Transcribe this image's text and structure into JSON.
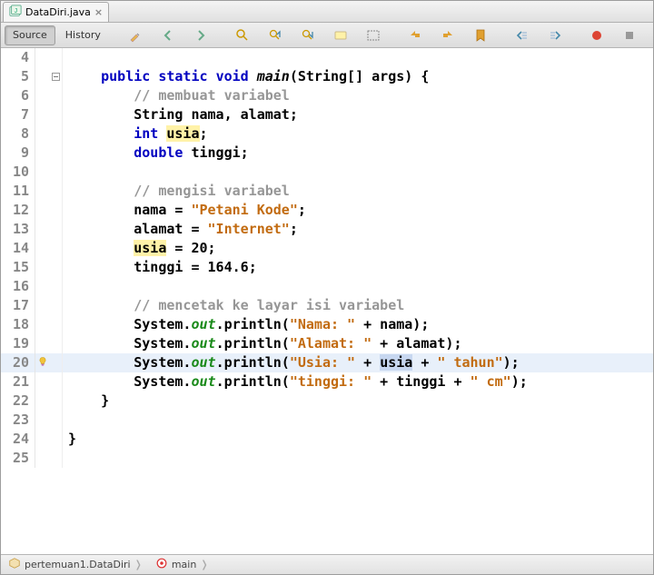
{
  "tab": {
    "filename": "DataDiri.java",
    "icon": "java-class-icon"
  },
  "toolbar": {
    "source_label": "Source",
    "history_label": "History"
  },
  "lines": [
    {
      "n": 4,
      "tokens": []
    },
    {
      "n": 5,
      "fold": "minus",
      "tokens": [
        {
          "cls": "punct",
          "t": "    "
        },
        {
          "cls": "kw",
          "t": "public"
        },
        {
          "cls": "punct",
          "t": " "
        },
        {
          "cls": "kw",
          "t": "static"
        },
        {
          "cls": "punct",
          "t": " "
        },
        {
          "cls": "kw",
          "t": "void"
        },
        {
          "cls": "punct",
          "t": " "
        },
        {
          "cls": "ident fn",
          "t": "main"
        },
        {
          "cls": "punct",
          "t": "(String[] args) {"
        }
      ]
    },
    {
      "n": 6,
      "tokens": [
        {
          "cls": "punct",
          "t": "        "
        },
        {
          "cls": "comment",
          "t": "// membuat variabel"
        }
      ]
    },
    {
      "n": 7,
      "tokens": [
        {
          "cls": "punct",
          "t": "        "
        },
        {
          "cls": "ident",
          "t": "String nama, alamat;"
        }
      ]
    },
    {
      "n": 8,
      "tokens": [
        {
          "cls": "punct",
          "t": "        "
        },
        {
          "cls": "kw",
          "t": "int"
        },
        {
          "cls": "punct",
          "t": " "
        },
        {
          "cls": "ident hl",
          "t": "usia"
        },
        {
          "cls": "punct",
          "t": ";"
        }
      ]
    },
    {
      "n": 9,
      "tokens": [
        {
          "cls": "punct",
          "t": "        "
        },
        {
          "cls": "kw",
          "t": "double"
        },
        {
          "cls": "punct",
          "t": " "
        },
        {
          "cls": "ident",
          "t": "tinggi;"
        }
      ]
    },
    {
      "n": 10,
      "tokens": []
    },
    {
      "n": 11,
      "tokens": [
        {
          "cls": "punct",
          "t": "        "
        },
        {
          "cls": "comment",
          "t": "// mengisi variabel"
        }
      ]
    },
    {
      "n": 12,
      "tokens": [
        {
          "cls": "punct",
          "t": "        "
        },
        {
          "cls": "ident",
          "t": "nama = "
        },
        {
          "cls": "str",
          "t": "\"Petani Kode\""
        },
        {
          "cls": "punct",
          "t": ";"
        }
      ]
    },
    {
      "n": 13,
      "tokens": [
        {
          "cls": "punct",
          "t": "        "
        },
        {
          "cls": "ident",
          "t": "alamat = "
        },
        {
          "cls": "str",
          "t": "\"Internet\""
        },
        {
          "cls": "punct",
          "t": ";"
        }
      ]
    },
    {
      "n": 14,
      "tokens": [
        {
          "cls": "punct",
          "t": "        "
        },
        {
          "cls": "ident hl",
          "t": "usia"
        },
        {
          "cls": "ident",
          "t": " = "
        },
        {
          "cls": "num",
          "t": "20"
        },
        {
          "cls": "punct",
          "t": ";"
        }
      ]
    },
    {
      "n": 15,
      "tokens": [
        {
          "cls": "punct",
          "t": "        "
        },
        {
          "cls": "ident",
          "t": "tinggi = "
        },
        {
          "cls": "num",
          "t": "164.6"
        },
        {
          "cls": "punct",
          "t": ";"
        }
      ]
    },
    {
      "n": 16,
      "tokens": []
    },
    {
      "n": 17,
      "tokens": [
        {
          "cls": "punct",
          "t": "        "
        },
        {
          "cls": "comment",
          "t": "// mencetak ke layar isi variabel"
        }
      ]
    },
    {
      "n": 18,
      "tokens": [
        {
          "cls": "punct",
          "t": "        "
        },
        {
          "cls": "ident",
          "t": "System."
        },
        {
          "cls": "out",
          "t": "out"
        },
        {
          "cls": "ident",
          "t": ".println("
        },
        {
          "cls": "str",
          "t": "\"Nama: \""
        },
        {
          "cls": "ident",
          "t": " + nama);"
        }
      ]
    },
    {
      "n": 19,
      "tokens": [
        {
          "cls": "punct",
          "t": "        "
        },
        {
          "cls": "ident",
          "t": "System."
        },
        {
          "cls": "out",
          "t": "out"
        },
        {
          "cls": "ident",
          "t": ".println("
        },
        {
          "cls": "str",
          "t": "\"Alamat: \""
        },
        {
          "cls": "ident",
          "t": " + alamat);"
        }
      ]
    },
    {
      "n": 20,
      "current": true,
      "glyph": "bulb",
      "tokens": [
        {
          "cls": "punct",
          "t": "        "
        },
        {
          "cls": "ident",
          "t": "System."
        },
        {
          "cls": "out",
          "t": "out"
        },
        {
          "cls": "ident",
          "t": ".println("
        },
        {
          "cls": "str",
          "t": "\"Usia: \""
        },
        {
          "cls": "ident",
          "t": " + "
        },
        {
          "cls": "ident sel",
          "t": "usia"
        },
        {
          "cls": "ident",
          "t": " + "
        },
        {
          "cls": "str",
          "t": "\" tahun\""
        },
        {
          "cls": "ident",
          "t": ");"
        }
      ]
    },
    {
      "n": 21,
      "tokens": [
        {
          "cls": "punct",
          "t": "        "
        },
        {
          "cls": "ident",
          "t": "System."
        },
        {
          "cls": "out",
          "t": "out"
        },
        {
          "cls": "ident",
          "t": ".println("
        },
        {
          "cls": "str",
          "t": "\"tinggi: \""
        },
        {
          "cls": "ident",
          "t": " + tinggi + "
        },
        {
          "cls": "str",
          "t": "\" cm\""
        },
        {
          "cls": "ident",
          "t": ");"
        }
      ]
    },
    {
      "n": 22,
      "tokens": [
        {
          "cls": "punct",
          "t": "    }"
        }
      ]
    },
    {
      "n": 23,
      "tokens": []
    },
    {
      "n": 24,
      "tokens": [
        {
          "cls": "punct",
          "t": "}"
        }
      ]
    },
    {
      "n": 25,
      "tokens": []
    }
  ],
  "breadcrumb": {
    "class_label": "pertemuan1.DataDiri",
    "method_label": "main"
  }
}
